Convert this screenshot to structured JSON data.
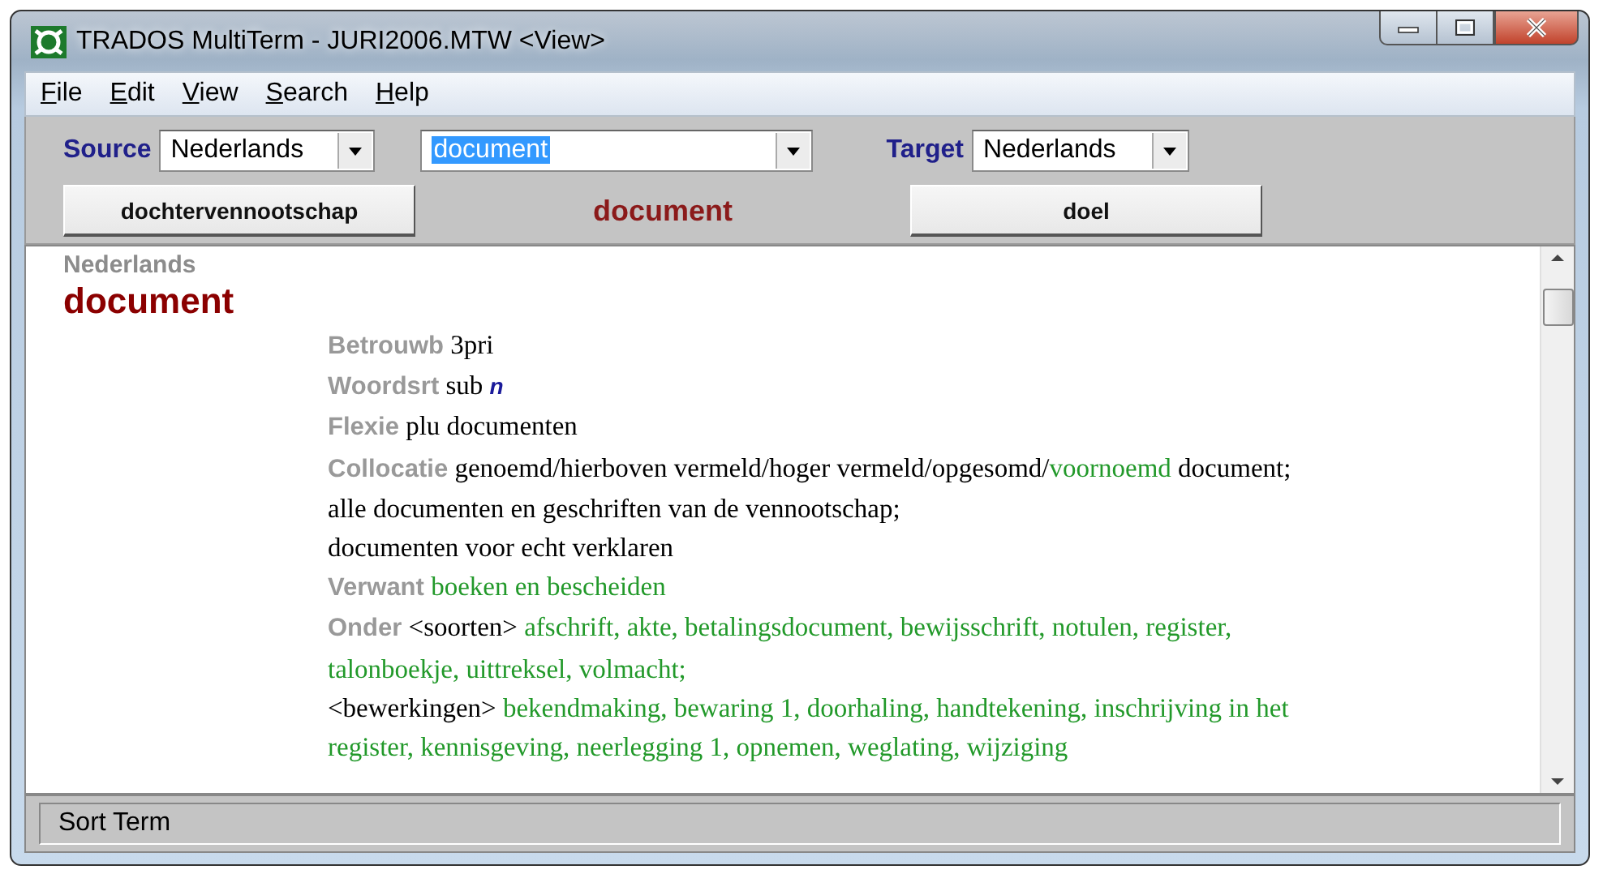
{
  "window": {
    "title": "TRADOS MultiTerm - JURI2006.MTW <View>"
  },
  "menu": [
    {
      "mnemonic": "F",
      "rest": "ile"
    },
    {
      "mnemonic": "E",
      "rest": "dit"
    },
    {
      "mnemonic": "V",
      "rest": "iew"
    },
    {
      "mnemonic": "S",
      "rest": "earch"
    },
    {
      "mnemonic": "H",
      "rest": "elp"
    }
  ],
  "toolbar": {
    "source": {
      "label": "Source",
      "value": "Nederlands"
    },
    "search": {
      "value": "document",
      "selected": true
    },
    "target": {
      "label": "Target",
      "value": "Nederlands"
    },
    "previous_term": "dochtervennootschap",
    "current_term": "document",
    "next_term": "doel"
  },
  "entry": {
    "language": "Nederlands",
    "term": "document",
    "fields": [
      {
        "label": "Betrouwb",
        "lines": [
          [
            {
              "kind": "text",
              "text": "3pri"
            }
          ]
        ]
      },
      {
        "label": "Woordsrt",
        "lines": [
          [
            {
              "kind": "text",
              "text": "sub"
            },
            {
              "kind": "gender",
              "text": "n"
            }
          ]
        ]
      },
      {
        "label": "Flexie",
        "lines": [
          [
            {
              "kind": "text",
              "text": "plu documenten"
            }
          ]
        ]
      },
      {
        "label": "Collocatie",
        "lines": [
          [
            {
              "kind": "text",
              "text": "genoemd/hierboven vermeld/hoger vermeld/opgesomd/"
            },
            {
              "kind": "link",
              "text": "voornoemd"
            },
            {
              "kind": "text",
              "text": " document;"
            }
          ],
          [
            {
              "kind": "text",
              "text": "alle documenten en geschriften van de vennootschap;"
            }
          ],
          [
            {
              "kind": "text",
              "text": "documenten voor echt verklaren"
            }
          ]
        ]
      },
      {
        "label": "Verwant",
        "lines": [
          [
            {
              "kind": "link",
              "text": "boeken en bescheiden"
            }
          ]
        ]
      },
      {
        "label": "Onder",
        "lines": [
          [
            {
              "kind": "text",
              "text": "<soorten> "
            },
            {
              "kind": "link",
              "text": "afschrift, akte, betalingsdocument, bewijsschrift, notulen, register,"
            }
          ],
          [
            {
              "kind": "link",
              "text": "talonboekje, uittreksel, volmacht;"
            }
          ],
          [
            {
              "kind": "text",
              "text": "<bewerkingen> "
            },
            {
              "kind": "link",
              "text": "bekendmaking, bewaring 1, doorhaling, handtekening, inschrijving in het"
            }
          ],
          [
            {
              "kind": "link",
              "text": "register, kennisgeving, neerlegging 1, opnemen, weglating, wijziging"
            }
          ]
        ]
      }
    ]
  },
  "status_bar": {
    "text": "Sort Term"
  }
}
